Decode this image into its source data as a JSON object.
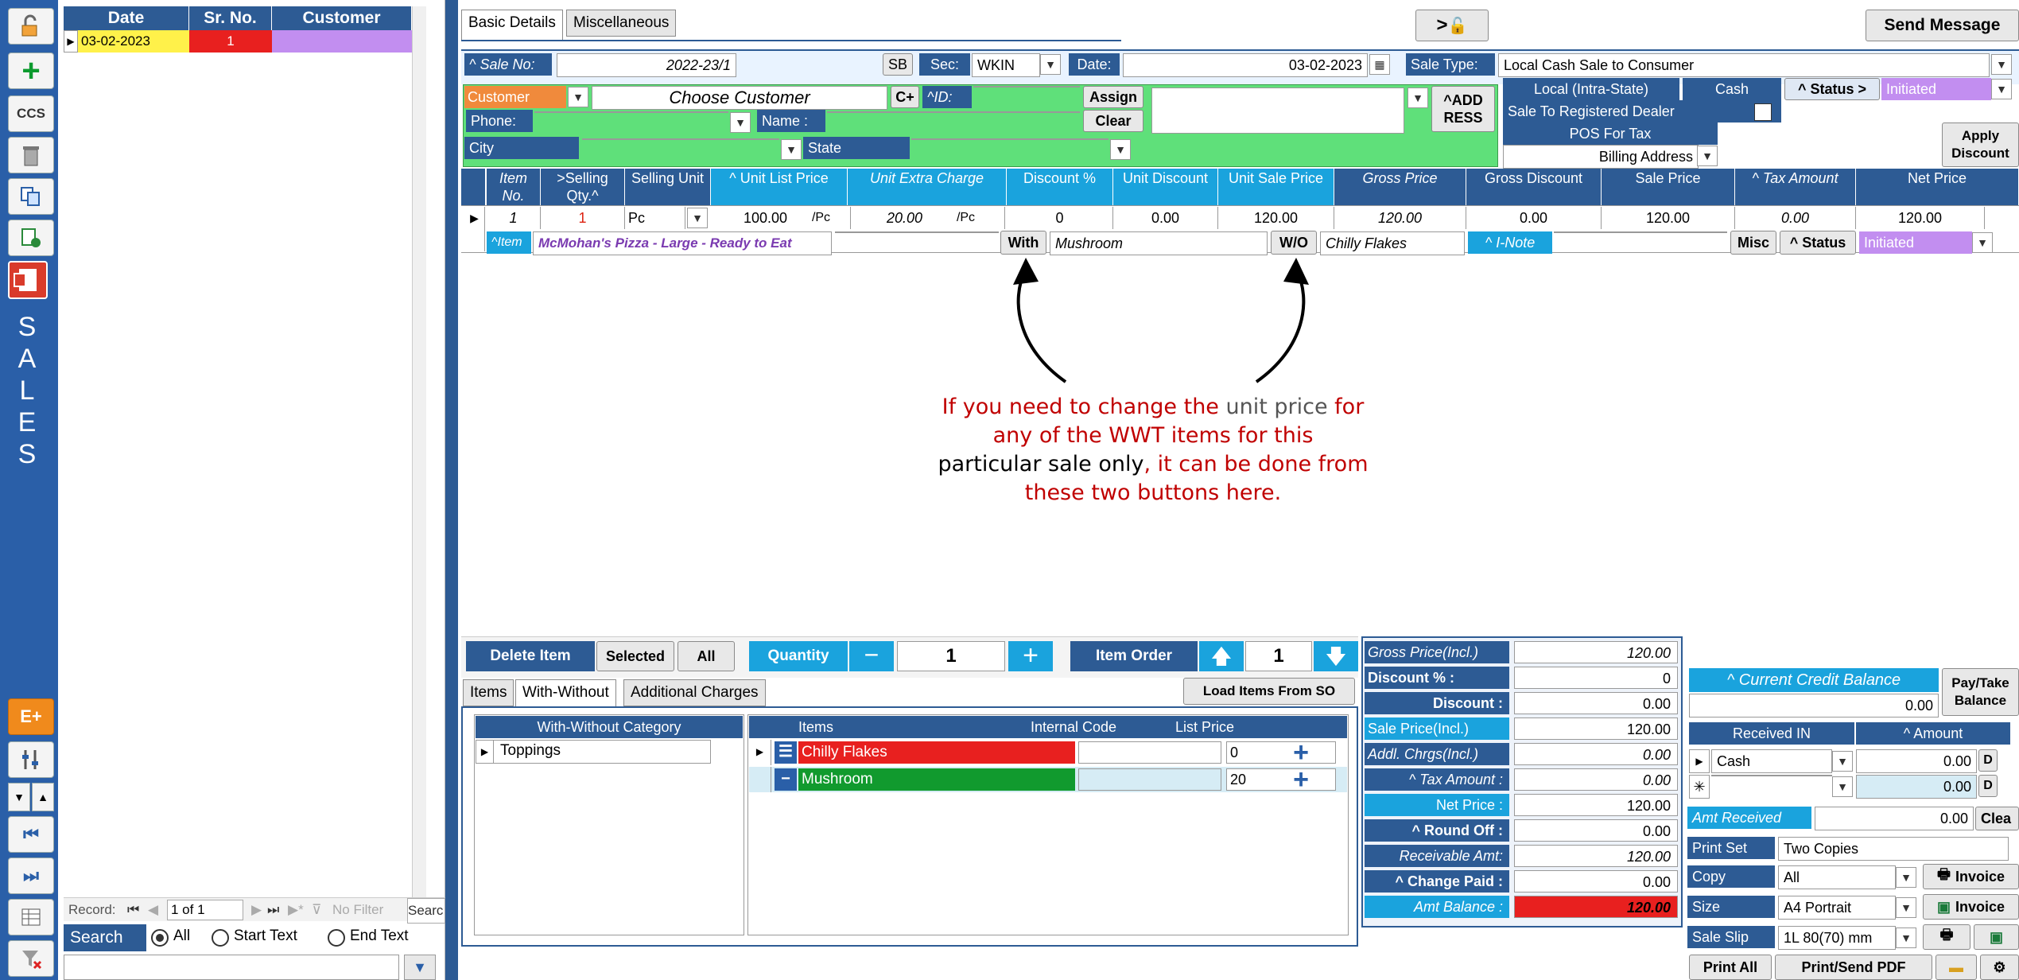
{
  "sidebar": {
    "ccs_label": "CCS",
    "eplus_label": "E+",
    "sales_letters": [
      "S",
      "A",
      "L",
      "E",
      "S"
    ]
  },
  "list": {
    "headers": [
      "Date",
      "Sr. No.",
      "Customer"
    ],
    "rows": [
      {
        "date": "03-02-2023",
        "sr": "1",
        "customer": ""
      }
    ],
    "record_label": "Record:",
    "record_value": "1 of 1",
    "no_filter": "No Filter",
    "search_btn": "Searc",
    "search_label": "Search",
    "opt_all": "All",
    "opt_start": "Start Text",
    "opt_end": "End Text"
  },
  "tabs": {
    "basic": "Basic Details",
    "misc": "Miscellaneous"
  },
  "top": {
    "lock_label": ">",
    "send_message": "Send Message"
  },
  "header": {
    "sale_no_label": "^ Sale No:",
    "sale_no": "2022-23/1",
    "sb": "SB",
    "sec_label": "Sec:",
    "sec_value": "WKIN",
    "date_label": "Date:",
    "date_value": "03-02-2023",
    "sale_type_label": "Sale Type:",
    "sale_type_value": "Local Cash Sale to Consumer",
    "customer_label": "Customer",
    "choose_customer": "Choose Customer",
    "cplus": "C+",
    "id_label": "^ID:",
    "assign": "Assign",
    "clear": "Clear",
    "address_btn": "^ADD RESS",
    "phone_label": "Phone:",
    "name_label": "Name :",
    "city_label": "City",
    "state_label": "State",
    "local_intra": "Local (Intra-State)",
    "cash": "Cash",
    "status_btn": "^ Status >",
    "status_value": "Initiated",
    "registered_dealer": "Sale To Registered Dealer",
    "pos_tax": "POS For Tax",
    "billing_address": "Billing Address",
    "apply_discount": "Apply Discount"
  },
  "grid": {
    "headers": [
      {
        "t": "Item No.",
        "i": true
      },
      {
        "t": ">Selling Qty.^",
        "i": false
      },
      {
        "t": "Selling Unit",
        "i": false
      },
      {
        "t": "^ Unit List Price",
        "i": false
      },
      {
        "t": "Unit Extra Charge",
        "i": true
      },
      {
        "t": "Discount %",
        "i": false
      },
      {
        "t": "Unit Discount",
        "i": false
      },
      {
        "t": "Unit Sale Price",
        "i": false
      },
      {
        "t": "Gross Price",
        "i": true
      },
      {
        "t": "Gross Discount",
        "i": false
      },
      {
        "t": "Sale Price",
        "i": false
      },
      {
        "t": "^ Tax Amount",
        "i": true
      },
      {
        "t": "Net Price",
        "i": false
      }
    ],
    "row": {
      "item_no": "1",
      "qty": "1",
      "unit": "Pc",
      "list_price": "100.00",
      "per1": "/Pc",
      "extra": "20.00",
      "per2": "/Pc",
      "disc_pct": "0",
      "unit_disc": "0.00",
      "unit_sale": "120.00",
      "gross": "120.00",
      "gross_disc": "0.00",
      "sale_price": "120.00",
      "tax": "0.00",
      "net": "120.00"
    },
    "item_label": "^Item",
    "item_name": "McMohan's Pizza - Large - Ready to Eat",
    "with_btn": "With",
    "with_value": "Mushroom",
    "wo_btn": "W/O",
    "wo_value": "Chilly Flakes",
    "inote_label": "^ I-Note",
    "misc_btn": "Misc",
    "status_btn": "^ Status",
    "status_value": "Initiated"
  },
  "annotation": {
    "line1a": "If you need to change the ",
    "line1b": "unit price",
    "line1c": " for",
    "line2": "any of the WWT items for this",
    "line3a": "particular sale only",
    "line3b": ", it can be done from",
    "line4": "these two buttons here."
  },
  "toolbar": {
    "delete_item": "Delete Item",
    "selected": "Selected",
    "all": "All",
    "quantity": "Quantity",
    "qty_value": "1",
    "item_order": "Item Order",
    "order_value": "1"
  },
  "subtabs": {
    "items": "Items",
    "with_without": "With-Without",
    "additional": "Additional Charges",
    "load_so": "Load Items From SO"
  },
  "wwt": {
    "category_header": "With-Without Category",
    "categories": [
      "Toppings"
    ],
    "items_headers": [
      "Items",
      "Internal Code",
      "List Price"
    ],
    "items": [
      {
        "name": "Chilly Flakes",
        "code": "",
        "price": "0",
        "color": "#e8201f"
      },
      {
        "name": "Mushroom",
        "code": "",
        "price": "20",
        "color": "#119a2e"
      }
    ]
  },
  "summary": [
    {
      "label": "Gross Price(Incl.)",
      "value": "120.00",
      "lstyle": "italic-left",
      "vstyle": "italic"
    },
    {
      "label": "Discount % :",
      "value": "0",
      "lstyle": "bold-left",
      "vstyle": "normal"
    },
    {
      "label": "Discount :",
      "value": "0.00",
      "lstyle": "bold-right",
      "vstyle": "normal"
    },
    {
      "label": "Sale Price(Incl.)",
      "value": "120.00",
      "lstyle": "cyan-left",
      "vstyle": "normal"
    },
    {
      "label": "Addl. Chrgs(Incl.)",
      "value": "0.00",
      "lstyle": "italic-left",
      "vstyle": "italic"
    },
    {
      "label": "^ Tax Amount :",
      "value": "0.00",
      "lstyle": "italic-right",
      "vstyle": "italic"
    },
    {
      "label": "Net Price :",
      "value": "120.00",
      "lstyle": "cyan-right",
      "vstyle": "normal"
    },
    {
      "label": "^ Round Off :",
      "value": "0.00",
      "lstyle": "bold-right",
      "vstyle": "normal"
    },
    {
      "label": "Receivable Amt:",
      "value": "120.00",
      "lstyle": "italic-right",
      "vstyle": "italic"
    },
    {
      "label": "^ Change Paid :",
      "value": "0.00",
      "lstyle": "bold-right",
      "vstyle": "normal"
    },
    {
      "label": "Amt Balance :",
      "value": "120.00",
      "lstyle": "cyan-italic-right",
      "vstyle": "red"
    }
  ],
  "payment": {
    "credit_balance": "^ Current Credit Balance",
    "credit_value": "0.00",
    "pay_take": "Pay/Take Balance",
    "received_in": "Received IN",
    "amount": "^ Amount",
    "rows": [
      {
        "mode": "Cash",
        "amount": "0.00",
        "d": "D"
      },
      {
        "mode": "",
        "amount": "0.00",
        "d": "D"
      }
    ],
    "amt_received": "Amt Received",
    "amt_received_value": "0.00",
    "clear": "Clea",
    "print_set_label": "Print Set",
    "print_set": "Two Copies",
    "copy_label": "Copy",
    "copy": "All",
    "invoice1": "Invoice",
    "size_label": "Size",
    "size": "A4 Portrait",
    "invoice2": "Invoice",
    "sale_slip_label": "Sale Slip",
    "sale_slip": "1L 80(70) mm",
    "print_all": "Print All",
    "print_send_pdf": "Print/Send PDF"
  }
}
